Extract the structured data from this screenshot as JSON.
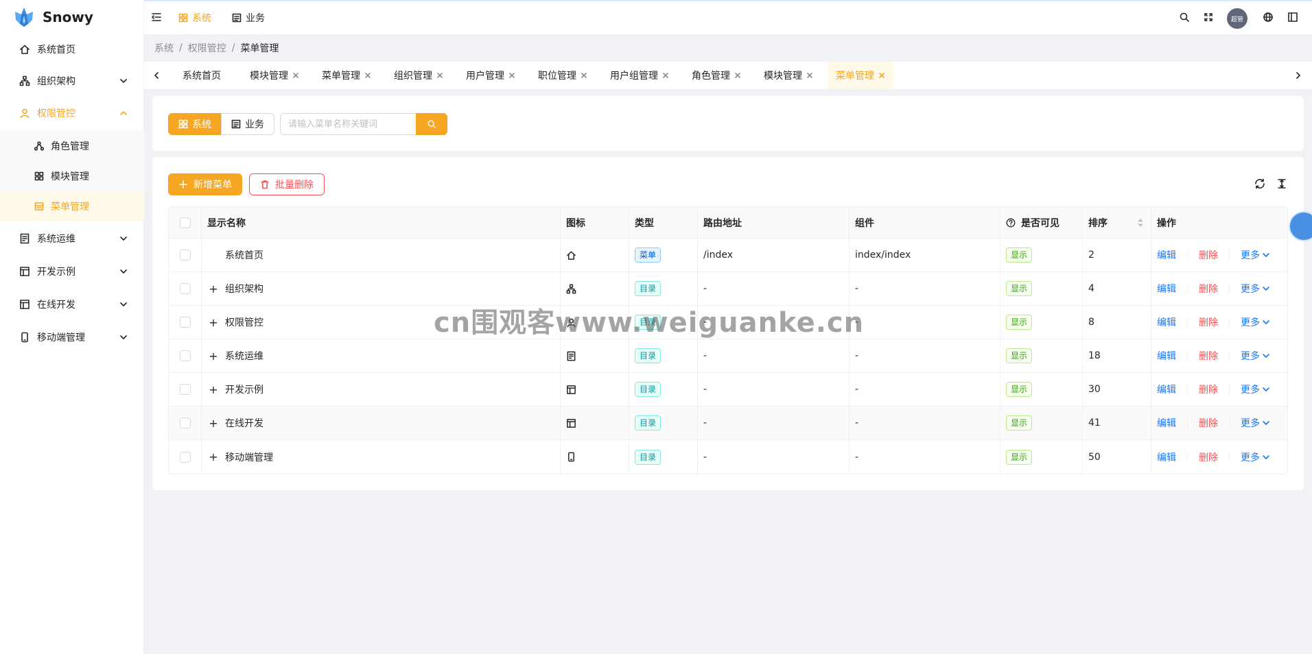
{
  "app": {
    "name": "Snowy"
  },
  "colors": {
    "accent": "#f5a623",
    "link": "#1677ff",
    "danger": "#ff4d4f"
  },
  "sidebar": {
    "items": [
      {
        "label": "系统首页",
        "icon": "home-icon"
      },
      {
        "label": "组织架构",
        "icon": "org-icon"
      },
      {
        "label": "权限管控",
        "icon": "user-icon"
      },
      {
        "label": "系统运维",
        "icon": "server-icon"
      },
      {
        "label": "开发示例",
        "icon": "layout-icon"
      },
      {
        "label": "在线开发",
        "icon": "layout-icon"
      },
      {
        "label": "移动端管理",
        "icon": "mobile-icon"
      }
    ],
    "submenu": [
      {
        "label": "角色管理",
        "icon": "cluster-icon"
      },
      {
        "label": "模块管理",
        "icon": "appstore-icon"
      },
      {
        "label": "菜单管理",
        "icon": "menu-icon"
      }
    ]
  },
  "header": {
    "module_system": "系统",
    "module_business": "业务",
    "avatar_text": "超管"
  },
  "breadcrumb": [
    "系统",
    "权限管控",
    "菜单管理"
  ],
  "tabs": [
    "系统首页",
    "模块管理",
    "菜单管理",
    "组织管理",
    "用户管理",
    "职位管理",
    "用户组管理",
    "角色管理",
    "模块管理",
    "菜单管理"
  ],
  "filter": {
    "seg_system": "系统",
    "seg_business": "业务",
    "search_placeholder": "请输入菜单名称关键词"
  },
  "toolbar": {
    "add_label": "新增菜单",
    "batch_delete_label": "批量删除"
  },
  "table": {
    "columns": {
      "name": "显示名称",
      "icon": "图标",
      "type": "类型",
      "path": "路由地址",
      "component": "组件",
      "visible": "是否可见",
      "sort": "排序",
      "ops": "操作"
    },
    "rows": [
      {
        "name": "系统首页",
        "icon": "home-icon",
        "type": "菜单",
        "path": "/index",
        "component": "index/index",
        "visible": "显示",
        "sort": "2"
      },
      {
        "name": "组织架构",
        "icon": "org-icon",
        "type": "目录",
        "path": "-",
        "component": "-",
        "visible": "显示",
        "sort": "4"
      },
      {
        "name": "权限管控",
        "icon": "user-icon",
        "type": "目录",
        "path": "-",
        "component": "-",
        "visible": "显示",
        "sort": "8"
      },
      {
        "name": "系统运维",
        "icon": "server-icon",
        "type": "目录",
        "path": "-",
        "component": "-",
        "visible": "显示",
        "sort": "18"
      },
      {
        "name": "开发示例",
        "icon": "layout-icon",
        "type": "目录",
        "path": "-",
        "component": "-",
        "visible": "显示",
        "sort": "30"
      },
      {
        "name": "在线开发",
        "icon": "layout-icon",
        "type": "目录",
        "path": "-",
        "component": "-",
        "visible": "显示",
        "sort": "41"
      },
      {
        "name": "移动端管理",
        "icon": "mobile-icon",
        "type": "目录",
        "path": "-",
        "component": "-",
        "visible": "显示",
        "sort": "50"
      }
    ],
    "ops": {
      "edit": "编辑",
      "delete": "删除",
      "more": "更多"
    }
  },
  "watermark": "cn围观客www.weiguanke.cn"
}
